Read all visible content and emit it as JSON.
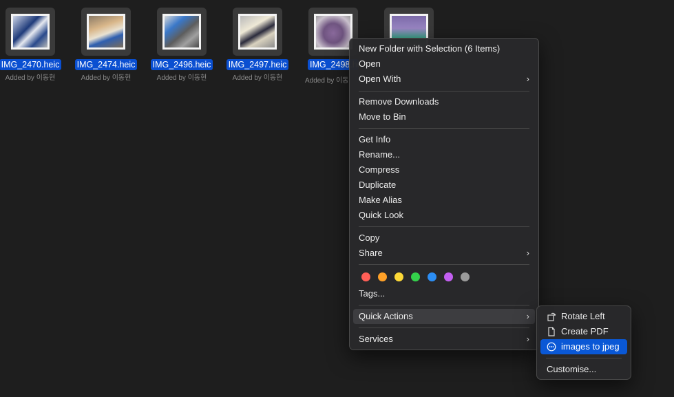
{
  "files": [
    {
      "name": "IMG_2470.heic",
      "added_by": "Added by 이동현"
    },
    {
      "name": "IMG_2474.heic",
      "added_by": "Added by 이동현"
    },
    {
      "name": "IMG_2496.heic",
      "added_by": "Added by 이동현"
    },
    {
      "name": "IMG_2497.heic",
      "added_by": "Added by 이동현"
    },
    {
      "name": "IMG_2498.heic",
      "added_by": "Added by 이동현"
    },
    {
      "name": "",
      "added_by": ""
    }
  ],
  "context_menu": {
    "new_folder": "New Folder with Selection (6 Items)",
    "open": "Open",
    "open_with": "Open With",
    "remove_downloads": "Remove Downloads",
    "move_to_bin": "Move to Bin",
    "get_info": "Get Info",
    "rename": "Rename...",
    "compress": "Compress",
    "duplicate": "Duplicate",
    "make_alias": "Make Alias",
    "quick_look": "Quick Look",
    "copy": "Copy",
    "share": "Share",
    "tags": "Tags...",
    "quick_actions": "Quick Actions",
    "services": "Services",
    "chevron": "›"
  },
  "tag_colors": [
    "#ff5f57",
    "#ffa128",
    "#fcd837",
    "#34d14b",
    "#2c8ef4",
    "#c35ff1",
    "#9a9a9a"
  ],
  "quick_actions_submenu": {
    "rotate_left": "Rotate Left",
    "create_pdf": "Create PDF",
    "images_to_jpeg": "images to jpeg",
    "customise": "Customise..."
  },
  "colors": {
    "selection_blue": "#0a4fd1",
    "menu_highlight_blue": "#0a58d6"
  }
}
